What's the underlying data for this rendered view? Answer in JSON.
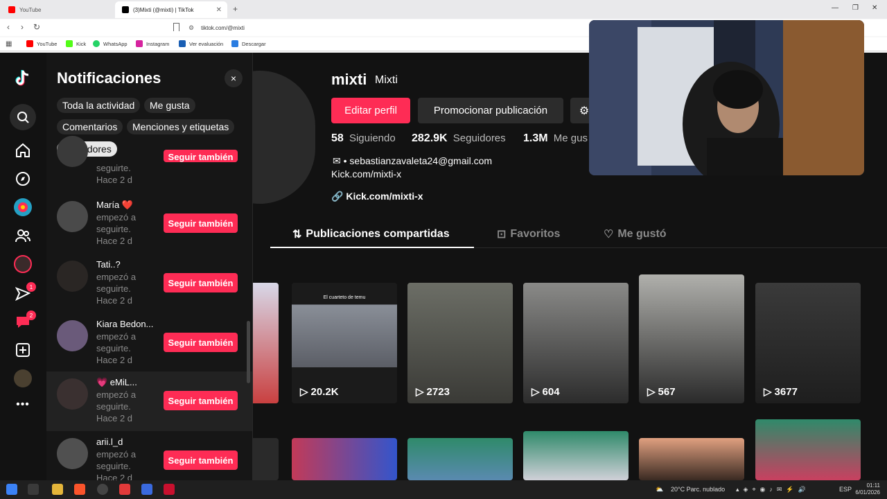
{
  "browser": {
    "tabs": [
      {
        "title": "YouTube",
        "active": false
      },
      {
        "title": "(3)Mixti (@mixti) | TikTok",
        "active": true
      }
    ],
    "new_tab": "+",
    "url": "tiktok.com/@mixti",
    "bookmarks": [
      "YouTube",
      "Kick",
      "WhatsApp",
      "Instagram",
      "Ver evaluación",
      "Descargar"
    ]
  },
  "rail": {
    "badges": {
      "inbox": "1",
      "messages": "2"
    }
  },
  "notifications": {
    "title": "Notificaciones",
    "close": "×",
    "filters": [
      "Toda la actividad",
      "Me gusta",
      "Comentarios",
      "Menciones y etiquetas",
      "Seguidores"
    ],
    "selected_filter": "Seguidores",
    "items": [
      {
        "name": "",
        "line1": "seguirte.",
        "line2": "Hace 2 d",
        "button": "Seguir también"
      },
      {
        "name": "María ❤️",
        "line1": "empezó a",
        "line2": "seguirte.",
        "line3": "Hace 2 d",
        "button": "Seguir también"
      },
      {
        "name": "Tati..?",
        "line1": "empezó a",
        "line2": "seguirte.",
        "line3": "Hace 2 d",
        "button": "Seguir también"
      },
      {
        "name": "Kiara Bedon...",
        "line1": "empezó a",
        "line2": "seguirte.",
        "line3": "Hace 2 d",
        "button": "Seguir también"
      },
      {
        "name": "💗 eMiL...",
        "line1": "empezó a",
        "line2": "seguirte.",
        "line3": "Hace 2 d",
        "button": "Seguir también"
      },
      {
        "name": "arii.l_d",
        "line1": "empezó a",
        "line2": "seguirte.",
        "line3": "Hace 2 d",
        "button": "Seguir también"
      }
    ]
  },
  "profile": {
    "username": "mixti",
    "nickname": "Mixti",
    "edit_button": "Editar perfil",
    "promote_button": "Promocionar publicación",
    "stats": [
      {
        "value": "58",
        "label": "Siguiendo"
      },
      {
        "value": "282.9K",
        "label": "Seguidores"
      },
      {
        "value": "1.3M",
        "label": "Me gus"
      }
    ],
    "bio_line1": "• sebastianzavaleta24@gmail.com",
    "bio_line2": "Kick.com/mixti-x",
    "link": "Kick.com/mixti-x",
    "tabs": [
      "Publicaciones compartidas",
      "Favoritos",
      "Me gustó"
    ]
  },
  "videos": [
    {
      "views": "",
      "caption": ""
    },
    {
      "views": "20.2K",
      "caption": "El cuarteto de temu"
    },
    {
      "views": "2723",
      "caption": ""
    },
    {
      "views": "604",
      "caption": ""
    },
    {
      "views": "567",
      "caption": ""
    },
    {
      "views": "3677",
      "caption": ""
    }
  ],
  "taskbar": {
    "weather": "20°C  Parc. nublado",
    "lang": "ESP",
    "time": "01:11",
    "date": "6/01/2026"
  }
}
